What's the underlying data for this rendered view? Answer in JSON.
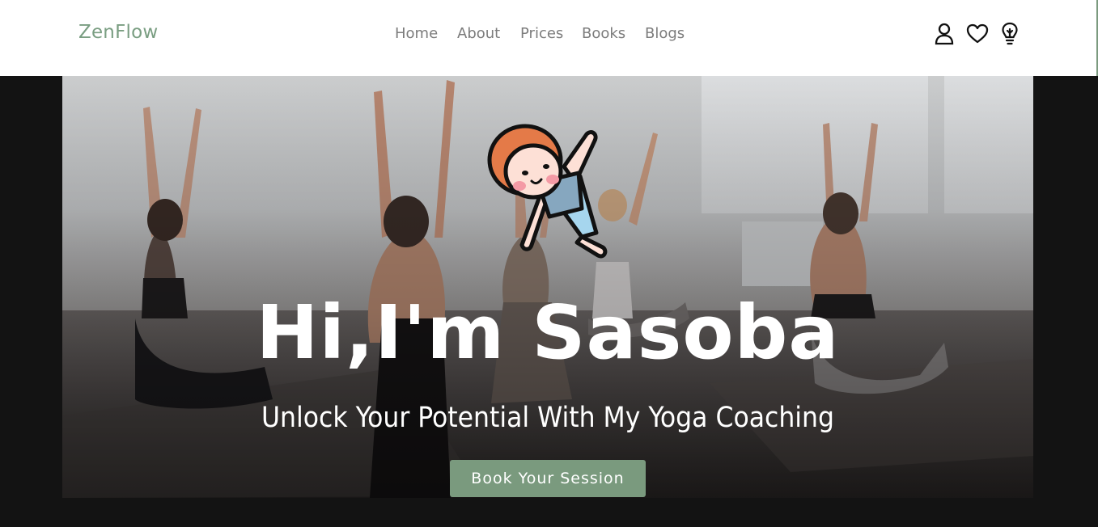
{
  "nav": {
    "brand": "ZenFlow",
    "links": [
      {
        "label": "Home"
      },
      {
        "label": "About"
      },
      {
        "label": "Prices"
      },
      {
        "label": "Books"
      },
      {
        "label": "Blogs"
      }
    ],
    "icons": [
      "user-icon",
      "heart-icon",
      "lightbulb-icon"
    ]
  },
  "hero": {
    "title": "Hi,I'm Sasoba",
    "subtitle": "Unlock Your Potential With My Yoga Coaching",
    "cta_label": "Book Your Session",
    "image_description": "mascot-yoga-child"
  },
  "colors": {
    "accent": "#7a9a7e",
    "brand_text": "#7a9e82",
    "nav_text": "#7c7c7c",
    "page_background": "#131313"
  }
}
